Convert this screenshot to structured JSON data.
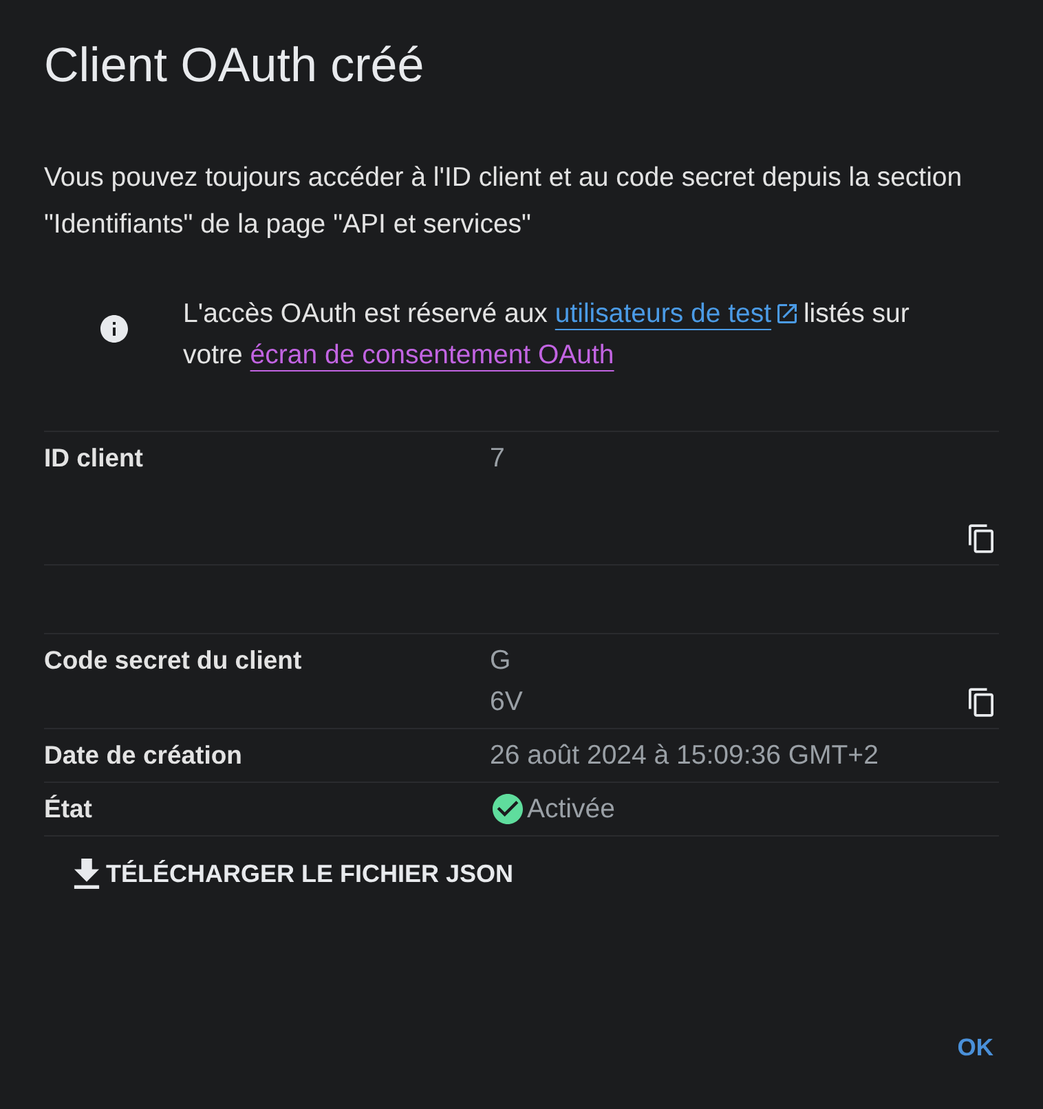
{
  "dialog": {
    "title": "Client OAuth créé",
    "description": "Vous pouvez toujours accéder à l'ID client et au code secret depuis la section \"Identifiants\" de la page \"API et services\""
  },
  "notice": {
    "parts": [
      {
        "kind": "text",
        "text": "L'accès OAuth est réservé aux "
      },
      {
        "kind": "link",
        "text": "utilisateurs de test",
        "external": true,
        "visited": false
      },
      {
        "kind": "text",
        "text": " listés sur votre "
      },
      {
        "kind": "link",
        "text": "écran de consentement OAuth",
        "external": false,
        "visited": true
      }
    ]
  },
  "details": [
    {
      "kind": "copy",
      "label": "ID client",
      "values": [
        "7"
      ]
    },
    {
      "kind": "copy",
      "label": "Code secret du client",
      "values": [
        "G",
        "6V"
      ]
    },
    {
      "kind": "text",
      "label": "Date de création",
      "values": [
        "26 août 2024 à 15:09:36 GMT+2"
      ]
    },
    {
      "kind": "status",
      "label": "État",
      "values": [
        "Activée"
      ],
      "enabled": true
    }
  ],
  "download_button": {
    "label": "TÉLÉCHARGER LE FICHIER JSON"
  },
  "actions": [
    {
      "label": "OK"
    }
  ]
}
